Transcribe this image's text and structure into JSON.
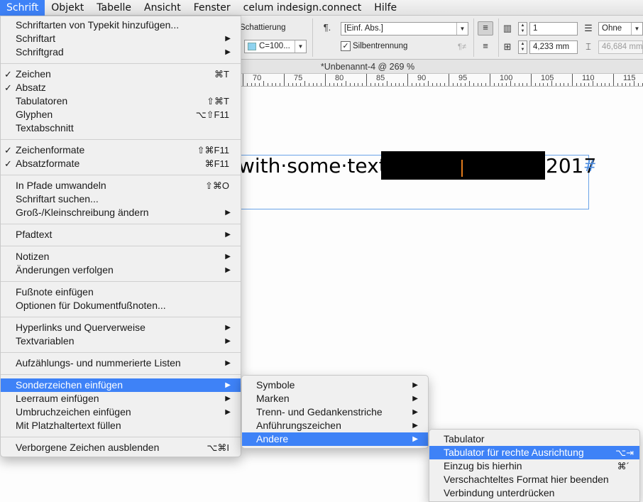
{
  "menubar": {
    "items": [
      "Schrift",
      "Objekt",
      "Tabelle",
      "Ansicht",
      "Fenster",
      "celum indesign.connect",
      "Hilfe"
    ]
  },
  "toolbar": {
    "shading_label": "Schattierung",
    "shading_color": "C=100...",
    "paragraph_style": "[Einf. Abs.]",
    "hyphenation_label": "Silbentrennung",
    "columns_value": "1",
    "spacing_value": "4,233 mm",
    "ohne_value": "Ohne",
    "disabled_value": "46,684 mm",
    "pilcrow_symbol": "¶.",
    "pilcrow_disabled": "¶≠",
    "checkbox_mark": "✓",
    "baseline_icon": "⌶"
  },
  "document": {
    "title": "*Unbenannt-4 @ 269 %",
    "ruler_labels": [
      "70",
      "75",
      "80",
      "85",
      "90",
      "95",
      "100",
      "105",
      "110",
      "115"
    ],
    "text_line": "with·some·text.",
    "text_year": "2017",
    "pilcrow": "#"
  },
  "colors": {
    "menu_highlight": "#3e82f7",
    "frame_border": "#6aa3e8",
    "caret": "#e27b1c",
    "shading_swatch": "#8fd3f0"
  },
  "menu_schrift": {
    "items": [
      {
        "label": "Schriftarten von Typekit hinzufügen...",
        "shortcut": "",
        "check": false,
        "arrow": false
      },
      {
        "label": "Schriftart",
        "shortcut": "",
        "check": false,
        "arrow": true
      },
      {
        "label": "Schriftgrad",
        "shortcut": "",
        "check": false,
        "arrow": true
      },
      {
        "label": "Zeichen",
        "shortcut": "⌘T",
        "check": true,
        "arrow": false
      },
      {
        "label": "Absatz",
        "shortcut": "",
        "check": true,
        "arrow": false
      },
      {
        "label": "Tabulatoren",
        "shortcut": "⇧⌘T",
        "check": false,
        "arrow": false
      },
      {
        "label": "Glyphen",
        "shortcut": "⌥⇧F11",
        "check": false,
        "arrow": false
      },
      {
        "label": "Textabschnitt",
        "shortcut": "",
        "check": false,
        "arrow": false
      },
      {
        "label": "Zeichenformate",
        "shortcut": "⇧⌘F11",
        "check": true,
        "arrow": false
      },
      {
        "label": "Absatzformate",
        "shortcut": "⌘F11",
        "check": true,
        "arrow": false
      },
      {
        "label": "In Pfade umwandeln",
        "shortcut": "⇧⌘O",
        "check": false,
        "arrow": false
      },
      {
        "label": "Schriftart suchen...",
        "shortcut": "",
        "check": false,
        "arrow": false
      },
      {
        "label": "Groß-/Kleinschreibung ändern",
        "shortcut": "",
        "check": false,
        "arrow": true
      },
      {
        "label": "Pfadtext",
        "shortcut": "",
        "check": false,
        "arrow": true
      },
      {
        "label": "Notizen",
        "shortcut": "",
        "check": false,
        "arrow": true
      },
      {
        "label": "Änderungen verfolgen",
        "shortcut": "",
        "check": false,
        "arrow": true
      },
      {
        "label": "Fußnote einfügen",
        "shortcut": "",
        "check": false,
        "arrow": false
      },
      {
        "label": "Optionen für Dokumentfußnoten...",
        "shortcut": "",
        "check": false,
        "arrow": false
      },
      {
        "label": "Hyperlinks und Querverweise",
        "shortcut": "",
        "check": false,
        "arrow": true
      },
      {
        "label": "Textvariablen",
        "shortcut": "",
        "check": false,
        "arrow": true
      },
      {
        "label": "Aufzählungs- und nummerierte Listen",
        "shortcut": "",
        "check": false,
        "arrow": true
      },
      {
        "label": "Sonderzeichen einfügen",
        "shortcut": "",
        "check": false,
        "arrow": true,
        "highlighted": true
      },
      {
        "label": "Leerraum einfügen",
        "shortcut": "",
        "check": false,
        "arrow": true
      },
      {
        "label": "Umbruchzeichen einfügen",
        "shortcut": "",
        "check": false,
        "arrow": true
      },
      {
        "label": "Mit Platzhaltertext füllen",
        "shortcut": "",
        "check": false,
        "arrow": false
      },
      {
        "label": "Verborgene Zeichen ausblenden",
        "shortcut": "⌥⌘I",
        "check": false,
        "arrow": false
      }
    ],
    "check_symbol": "✓",
    "arrow_symbol": "▶"
  },
  "submenu_sonderzeichen": {
    "items": [
      {
        "label": "Symbole",
        "arrow": true
      },
      {
        "label": "Marken",
        "arrow": true
      },
      {
        "label": "Trenn- und Gedankenstriche",
        "arrow": true
      },
      {
        "label": "Anführungszeichen",
        "arrow": true
      },
      {
        "label": "Andere",
        "arrow": true,
        "highlighted": true
      }
    ]
  },
  "submenu_andere": {
    "items": [
      {
        "label": "Tabulator",
        "shortcut": ""
      },
      {
        "label": "Tabulator für rechte Ausrichtung",
        "shortcut": "⌥⇥",
        "highlighted": true
      },
      {
        "label": "Einzug bis hierhin",
        "shortcut": "⌘´"
      },
      {
        "label": "Verschachteltes Format hier beenden",
        "shortcut": ""
      },
      {
        "label": "Verbindung unterdrücken",
        "shortcut": ""
      }
    ]
  }
}
